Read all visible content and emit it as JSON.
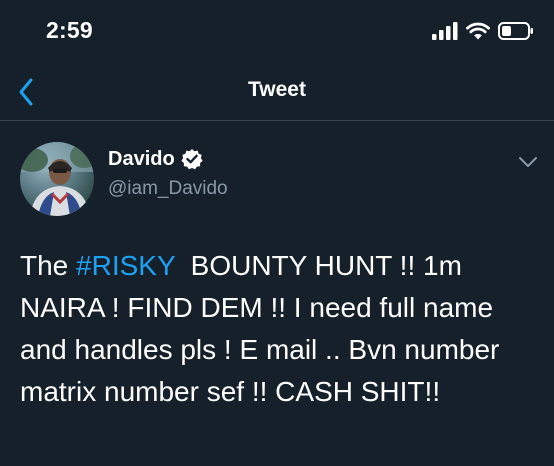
{
  "status_bar": {
    "time": "2:59",
    "icons": [
      "signal-bars-icon",
      "wifi-icon",
      "battery-icon"
    ]
  },
  "nav": {
    "back_icon": "chevron-left-icon",
    "title": "Tweet"
  },
  "tweet": {
    "author": {
      "display_name": "Davido",
      "verified_icon": "verified-badge-icon",
      "handle": "@iam_Davido"
    },
    "menu_icon": "chevron-down-icon",
    "text": {
      "line1_prefix": "The ",
      "hashtag": "#RISKY",
      "line1_suffix": "  BOUNTY HUNT !! 1m",
      "line2": "NAIRA ! FIND DEM !! I need full name",
      "line3": "and handles pls ! E mail .. Bvn number",
      "line4": "matrix number sef !! CASH SHIT!!"
    }
  },
  "colors": {
    "background": "#15202B",
    "accent": "#1DA1F2",
    "secondary_text": "#8899A6",
    "divider": "#38444D"
  }
}
